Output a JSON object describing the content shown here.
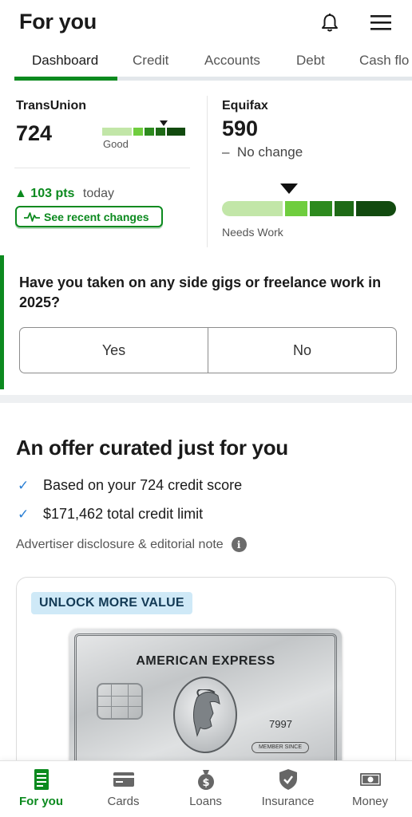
{
  "header": {
    "title": "For you",
    "icons": [
      "bell-icon",
      "hamburger-menu-icon"
    ]
  },
  "tabs": [
    {
      "label": "Dashboard",
      "active": true
    },
    {
      "label": "Credit",
      "active": false
    },
    {
      "label": "Accounts",
      "active": false
    },
    {
      "label": "Debt",
      "active": false
    },
    {
      "label": "Cash flo",
      "active": false
    }
  ],
  "scores": {
    "transunion": {
      "bureau": "TransUnion",
      "score": "724",
      "rating": "Good",
      "change_value": "103 pts",
      "change_period": "today",
      "see_changes_label": "See recent changes"
    },
    "equifax": {
      "bureau": "Equifax",
      "score": "590",
      "change_text": "No change",
      "rating": "Needs Work"
    },
    "bar_colors": [
      "#c2e6a8",
      "#6fcd3e",
      "#2d8a1e",
      "#1e6a16",
      "#124a0f"
    ]
  },
  "question": {
    "text": "Have you taken on any side gigs or freelance work in 2025?",
    "yes_label": "Yes",
    "no_label": "No"
  },
  "offer": {
    "title": "An offer curated just for you",
    "bullets": [
      "Based on your 724 credit score",
      "$171,462 total credit limit"
    ],
    "disclosure": "Advertiser disclosure & editorial note",
    "badge": "UNLOCK MORE VALUE",
    "card_brand": "AMERICAN EXPRESS",
    "card_number": "7997",
    "member_text": "MEMBER SINCE"
  },
  "bottom_nav": [
    {
      "label": "For you",
      "icon": "document-list-icon",
      "active": true
    },
    {
      "label": "Cards",
      "icon": "credit-card-icon",
      "active": false
    },
    {
      "label": "Loans",
      "icon": "money-bag-icon",
      "active": false
    },
    {
      "label": "Insurance",
      "icon": "shield-check-icon",
      "active": false
    },
    {
      "label": "Money",
      "icon": "banknote-icon",
      "active": false
    }
  ],
  "colors": {
    "accent_green": "#0c8a1f",
    "check_blue": "#2a7fd4",
    "badge_bg": "#cfe9f7"
  }
}
